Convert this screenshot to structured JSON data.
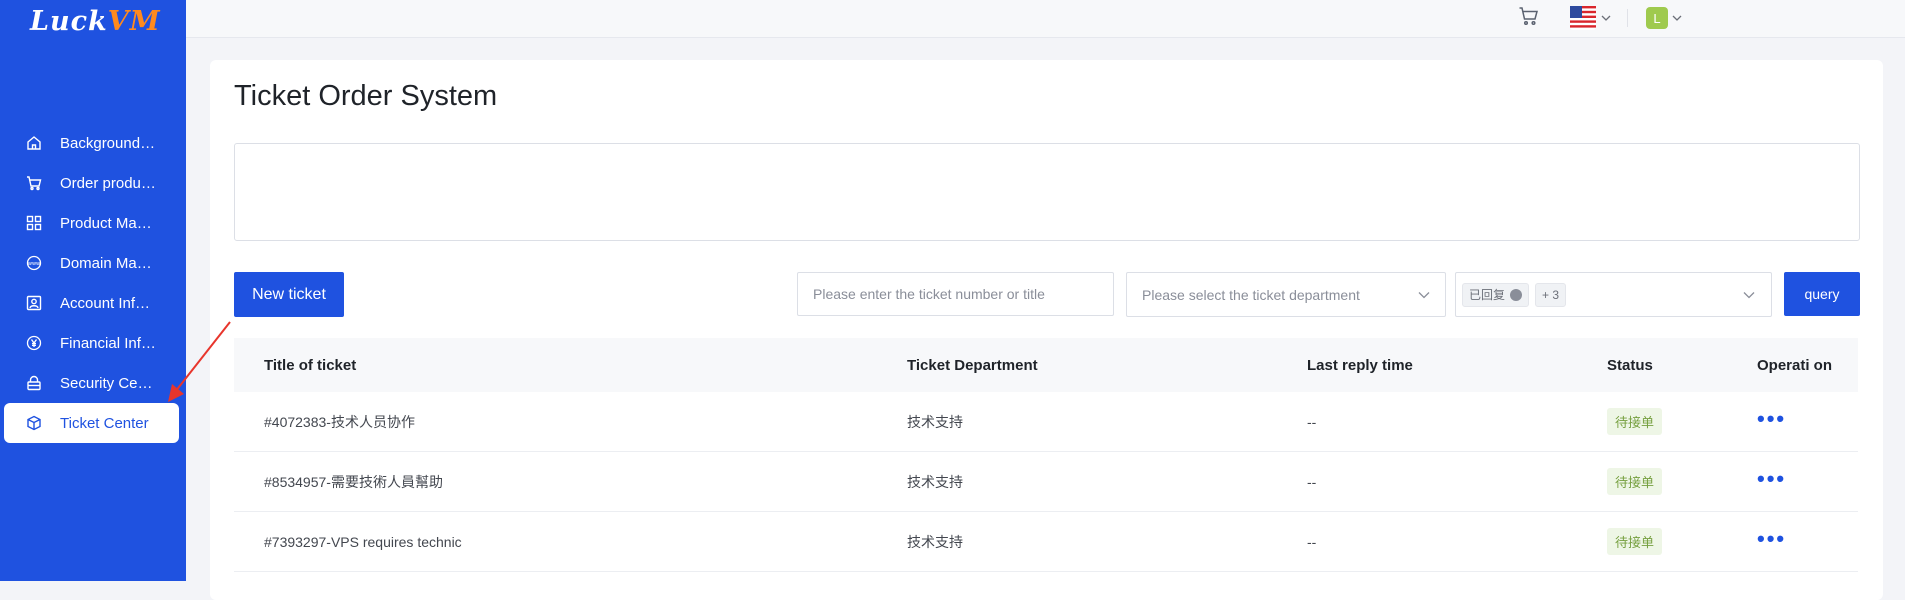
{
  "sidebar": {
    "logo_main": "Luck",
    "logo_accent": "VM",
    "items": [
      {
        "label": "Background …",
        "icon": "home-icon"
      },
      {
        "label": "Order produ…",
        "icon": "cart-icon"
      },
      {
        "label": "Product Man…",
        "icon": "grid-icon"
      },
      {
        "label": "Domain Man…",
        "icon": "www-icon"
      },
      {
        "label": "Account Info…",
        "icon": "user-card-icon"
      },
      {
        "label": "Financial Inf…",
        "icon": "yen-icon"
      },
      {
        "label": "Security Cen…",
        "icon": "lock-icon"
      },
      {
        "label": "Ticket Center",
        "icon": "cube-icon",
        "active": true
      }
    ]
  },
  "header": {
    "avatar_letter": "L"
  },
  "main": {
    "title": "Ticket Order System",
    "new_ticket_label": "New ticket",
    "search_placeholder": "Please enter the ticket number or title",
    "department_placeholder": "Please select the ticket department",
    "status_tag": "已回复",
    "status_more": "+ 3",
    "query_label": "query"
  },
  "table": {
    "columns": [
      "Title of ticket",
      "Ticket Department",
      "Last reply time",
      "Status",
      "Operati on"
    ],
    "rows": [
      {
        "title": "#4072383-技术人员协作",
        "department": "技术支持",
        "last_reply": "--",
        "status": "待接单"
      },
      {
        "title": "#8534957-需要技術人員幫助",
        "department": "技术支持",
        "last_reply": "--",
        "status": "待接单"
      },
      {
        "title": "#7393297-VPS requires technic",
        "department": "技术支持",
        "last_reply": "--",
        "status": "待接单"
      }
    ],
    "operation_glyph": "•••"
  },
  "colors": {
    "brand": "#1f52e0",
    "accent": "#ff8a1d",
    "status_badge_bg": "#eef6e6",
    "status_badge_text": "#76a040",
    "annotation_arrow": "#e8352c"
  }
}
